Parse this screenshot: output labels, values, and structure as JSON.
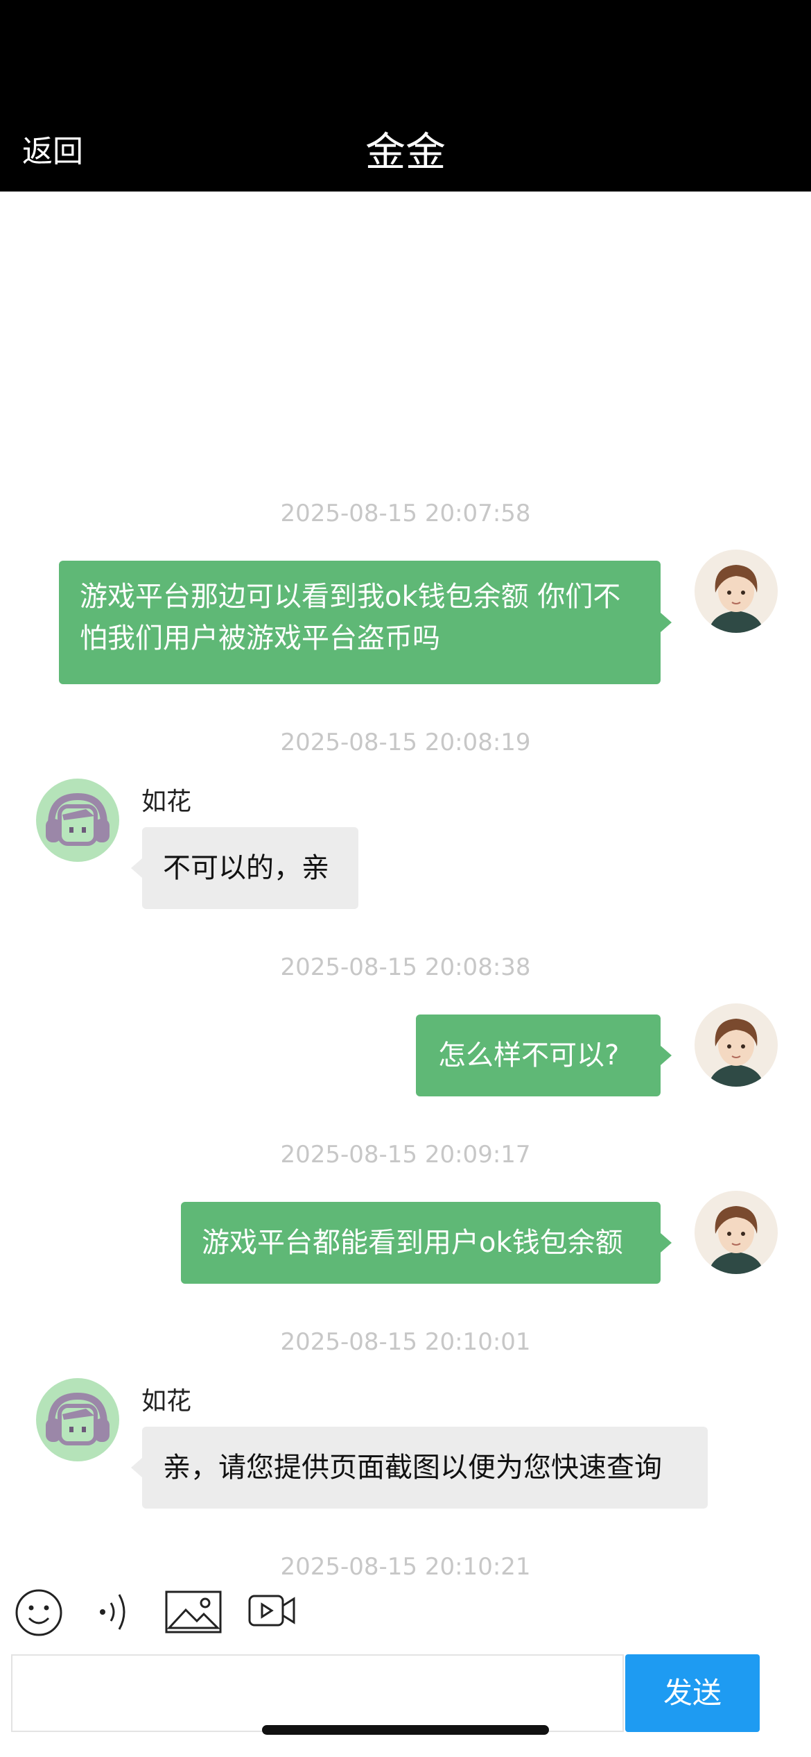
{
  "header": {
    "back_label": "返回",
    "title": "金金"
  },
  "messages": [
    {
      "time": "2025-08-15 20:07:58",
      "text": "游戏平台那边可以看到我ok钱包余额 你们不怕我们用户被游戏平台盗币吗"
    },
    {
      "time": "2025-08-15 20:08:19",
      "sender": "如花",
      "text": "不可以的，亲"
    },
    {
      "time": "2025-08-15 20:08:38",
      "text": "怎么样不可以?"
    },
    {
      "time": "2025-08-15 20:09:17",
      "text": "游戏平台都能看到用户ok钱包余额"
    },
    {
      "time": "2025-08-15 20:10:01",
      "sender": "如花",
      "text": "亲，请您提供页面截图以便为您快速查询"
    },
    {
      "time": "2025-08-15 20:10:21"
    }
  ],
  "composer": {
    "value": "",
    "send_label": "发送"
  },
  "toolbar": {
    "icons": [
      "emoji-icon",
      "voice-icon",
      "image-icon",
      "video-icon"
    ]
  },
  "colors": {
    "outgoing_bubble": "#5fb876",
    "incoming_bubble": "#ececec",
    "header_bg": "#000000",
    "send_button": "#1e9bf2"
  }
}
